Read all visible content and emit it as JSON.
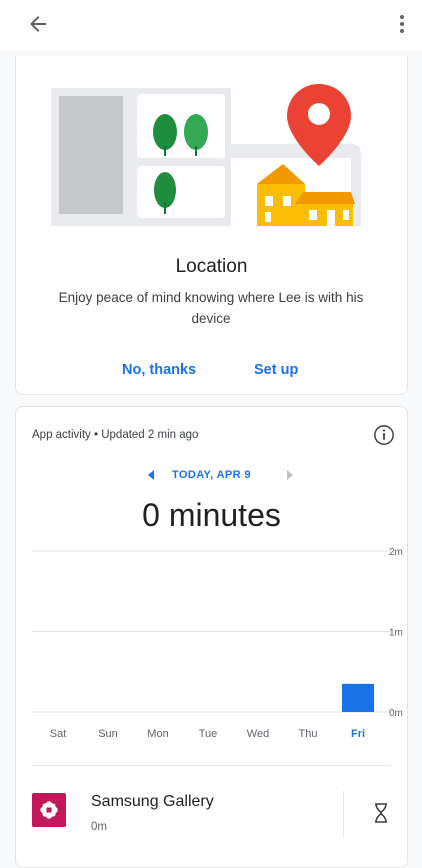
{
  "location_card": {
    "title": "Location",
    "description": "Enjoy peace of mind knowing where Lee is with his device",
    "no_thanks_label": "No, thanks",
    "setup_label": "Set up"
  },
  "activity_card": {
    "header": "App activity • Updated 2 min ago",
    "date_label": "TODAY, APR 9",
    "total": "0 minutes",
    "selected_day": "Fri",
    "app": {
      "name": "Samsung Gallery",
      "time": "0m",
      "icon_color": "#c2185b"
    }
  },
  "chart_data": {
    "type": "bar",
    "categories": [
      "Sat",
      "Sun",
      "Mon",
      "Tue",
      "Wed",
      "Thu",
      "Fri"
    ],
    "values": [
      0,
      0,
      0,
      0,
      0,
      0,
      0.35
    ],
    "y_ticks": [
      "2m",
      "1m",
      "0m"
    ],
    "ylim": [
      0,
      2
    ],
    "unit": "minutes",
    "grid": true,
    "bar_color": "#1a73e8"
  }
}
